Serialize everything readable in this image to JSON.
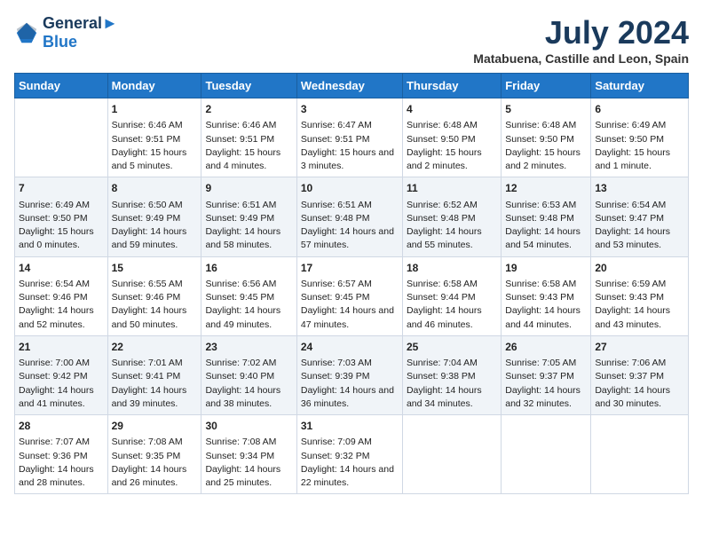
{
  "logo": {
    "line1": "General",
    "line2": "Blue"
  },
  "title": "July 2024",
  "subtitle": "Matabuena, Castille and Leon, Spain",
  "days_of_week": [
    "Sunday",
    "Monday",
    "Tuesday",
    "Wednesday",
    "Thursday",
    "Friday",
    "Saturday"
  ],
  "weeks": [
    [
      {
        "day": "",
        "sunrise": "",
        "sunset": "",
        "daylight": ""
      },
      {
        "day": "1",
        "sunrise": "Sunrise: 6:46 AM",
        "sunset": "Sunset: 9:51 PM",
        "daylight": "Daylight: 15 hours and 5 minutes."
      },
      {
        "day": "2",
        "sunrise": "Sunrise: 6:46 AM",
        "sunset": "Sunset: 9:51 PM",
        "daylight": "Daylight: 15 hours and 4 minutes."
      },
      {
        "day": "3",
        "sunrise": "Sunrise: 6:47 AM",
        "sunset": "Sunset: 9:51 PM",
        "daylight": "Daylight: 15 hours and 3 minutes."
      },
      {
        "day": "4",
        "sunrise": "Sunrise: 6:48 AM",
        "sunset": "Sunset: 9:50 PM",
        "daylight": "Daylight: 15 hours and 2 minutes."
      },
      {
        "day": "5",
        "sunrise": "Sunrise: 6:48 AM",
        "sunset": "Sunset: 9:50 PM",
        "daylight": "Daylight: 15 hours and 2 minutes."
      },
      {
        "day": "6",
        "sunrise": "Sunrise: 6:49 AM",
        "sunset": "Sunset: 9:50 PM",
        "daylight": "Daylight: 15 hours and 1 minute."
      }
    ],
    [
      {
        "day": "7",
        "sunrise": "Sunrise: 6:49 AM",
        "sunset": "Sunset: 9:50 PM",
        "daylight": "Daylight: 15 hours and 0 minutes."
      },
      {
        "day": "8",
        "sunrise": "Sunrise: 6:50 AM",
        "sunset": "Sunset: 9:49 PM",
        "daylight": "Daylight: 14 hours and 59 minutes."
      },
      {
        "day": "9",
        "sunrise": "Sunrise: 6:51 AM",
        "sunset": "Sunset: 9:49 PM",
        "daylight": "Daylight: 14 hours and 58 minutes."
      },
      {
        "day": "10",
        "sunrise": "Sunrise: 6:51 AM",
        "sunset": "Sunset: 9:48 PM",
        "daylight": "Daylight: 14 hours and 57 minutes."
      },
      {
        "day": "11",
        "sunrise": "Sunrise: 6:52 AM",
        "sunset": "Sunset: 9:48 PM",
        "daylight": "Daylight: 14 hours and 55 minutes."
      },
      {
        "day": "12",
        "sunrise": "Sunrise: 6:53 AM",
        "sunset": "Sunset: 9:48 PM",
        "daylight": "Daylight: 14 hours and 54 minutes."
      },
      {
        "day": "13",
        "sunrise": "Sunrise: 6:54 AM",
        "sunset": "Sunset: 9:47 PM",
        "daylight": "Daylight: 14 hours and 53 minutes."
      }
    ],
    [
      {
        "day": "14",
        "sunrise": "Sunrise: 6:54 AM",
        "sunset": "Sunset: 9:46 PM",
        "daylight": "Daylight: 14 hours and 52 minutes."
      },
      {
        "day": "15",
        "sunrise": "Sunrise: 6:55 AM",
        "sunset": "Sunset: 9:46 PM",
        "daylight": "Daylight: 14 hours and 50 minutes."
      },
      {
        "day": "16",
        "sunrise": "Sunrise: 6:56 AM",
        "sunset": "Sunset: 9:45 PM",
        "daylight": "Daylight: 14 hours and 49 minutes."
      },
      {
        "day": "17",
        "sunrise": "Sunrise: 6:57 AM",
        "sunset": "Sunset: 9:45 PM",
        "daylight": "Daylight: 14 hours and 47 minutes."
      },
      {
        "day": "18",
        "sunrise": "Sunrise: 6:58 AM",
        "sunset": "Sunset: 9:44 PM",
        "daylight": "Daylight: 14 hours and 46 minutes."
      },
      {
        "day": "19",
        "sunrise": "Sunrise: 6:58 AM",
        "sunset": "Sunset: 9:43 PM",
        "daylight": "Daylight: 14 hours and 44 minutes."
      },
      {
        "day": "20",
        "sunrise": "Sunrise: 6:59 AM",
        "sunset": "Sunset: 9:43 PM",
        "daylight": "Daylight: 14 hours and 43 minutes."
      }
    ],
    [
      {
        "day": "21",
        "sunrise": "Sunrise: 7:00 AM",
        "sunset": "Sunset: 9:42 PM",
        "daylight": "Daylight: 14 hours and 41 minutes."
      },
      {
        "day": "22",
        "sunrise": "Sunrise: 7:01 AM",
        "sunset": "Sunset: 9:41 PM",
        "daylight": "Daylight: 14 hours and 39 minutes."
      },
      {
        "day": "23",
        "sunrise": "Sunrise: 7:02 AM",
        "sunset": "Sunset: 9:40 PM",
        "daylight": "Daylight: 14 hours and 38 minutes."
      },
      {
        "day": "24",
        "sunrise": "Sunrise: 7:03 AM",
        "sunset": "Sunset: 9:39 PM",
        "daylight": "Daylight: 14 hours and 36 minutes."
      },
      {
        "day": "25",
        "sunrise": "Sunrise: 7:04 AM",
        "sunset": "Sunset: 9:38 PM",
        "daylight": "Daylight: 14 hours and 34 minutes."
      },
      {
        "day": "26",
        "sunrise": "Sunrise: 7:05 AM",
        "sunset": "Sunset: 9:37 PM",
        "daylight": "Daylight: 14 hours and 32 minutes."
      },
      {
        "day": "27",
        "sunrise": "Sunrise: 7:06 AM",
        "sunset": "Sunset: 9:37 PM",
        "daylight": "Daylight: 14 hours and 30 minutes."
      }
    ],
    [
      {
        "day": "28",
        "sunrise": "Sunrise: 7:07 AM",
        "sunset": "Sunset: 9:36 PM",
        "daylight": "Daylight: 14 hours and 28 minutes."
      },
      {
        "day": "29",
        "sunrise": "Sunrise: 7:08 AM",
        "sunset": "Sunset: 9:35 PM",
        "daylight": "Daylight: 14 hours and 26 minutes."
      },
      {
        "day": "30",
        "sunrise": "Sunrise: 7:08 AM",
        "sunset": "Sunset: 9:34 PM",
        "daylight": "Daylight: 14 hours and 25 minutes."
      },
      {
        "day": "31",
        "sunrise": "Sunrise: 7:09 AM",
        "sunset": "Sunset: 9:32 PM",
        "daylight": "Daylight: 14 hours and 22 minutes."
      },
      {
        "day": "",
        "sunrise": "",
        "sunset": "",
        "daylight": ""
      },
      {
        "day": "",
        "sunrise": "",
        "sunset": "",
        "daylight": ""
      },
      {
        "day": "",
        "sunrise": "",
        "sunset": "",
        "daylight": ""
      }
    ]
  ]
}
